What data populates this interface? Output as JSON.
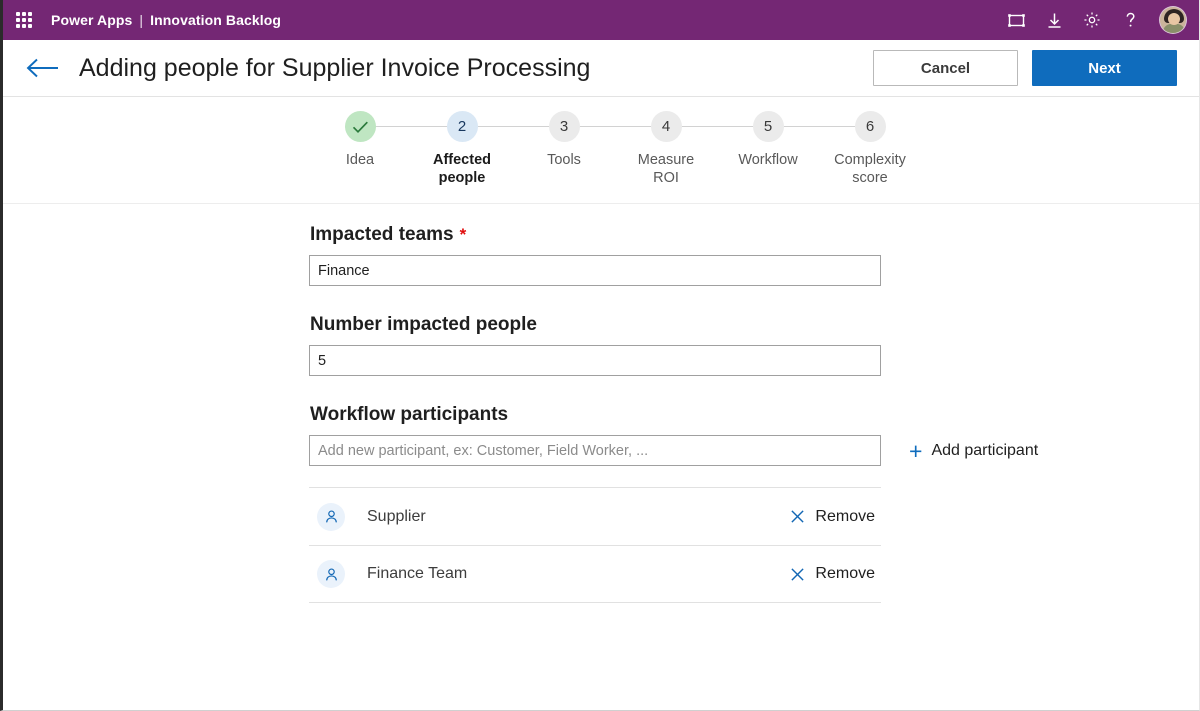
{
  "suitebar": {
    "waffle_name": "app-launcher",
    "brand_product": "Power Apps",
    "brand_separator": "|",
    "brand_app": "Innovation Backlog",
    "icons": [
      {
        "name": "fullscreen-icon",
        "title": "Fullscreen"
      },
      {
        "name": "download-icon",
        "title": "Download"
      },
      {
        "name": "gear-icon",
        "title": "Settings"
      },
      {
        "name": "help-icon",
        "title": "Help"
      }
    ],
    "avatar_name": "user-avatar"
  },
  "header": {
    "back_label": "Back",
    "title": "Adding people for Supplier Invoice Processing",
    "cancel_label": "Cancel",
    "next_label": "Next"
  },
  "stepper": {
    "current": 2,
    "steps": [
      {
        "number": "1",
        "glyph": "check",
        "label": "Idea",
        "state": "done"
      },
      {
        "number": "2",
        "glyph": "2",
        "label": "Affected\npeople",
        "state": "active"
      },
      {
        "number": "3",
        "glyph": "3",
        "label": "Tools",
        "state": "todo"
      },
      {
        "number": "4",
        "glyph": "4",
        "label": "Measure\nROI",
        "state": "todo"
      },
      {
        "number": "5",
        "glyph": "5",
        "label": "Workflow",
        "state": "todo"
      },
      {
        "number": "6",
        "glyph": "6",
        "label": "Complexity\nscore",
        "state": "todo"
      }
    ]
  },
  "form": {
    "impacted_teams": {
      "label": "Impacted teams",
      "required_marker": "*",
      "value": "Finance",
      "placeholder": ""
    },
    "number_impacted_people": {
      "label": "Number impacted people",
      "value": "5",
      "placeholder": ""
    },
    "workflow_participants": {
      "label": "Workflow participants",
      "value": "",
      "placeholder": "Add new participant, ex: Customer, Field Worker, ...",
      "add_label": "Add participant",
      "add_icon": "plus-icon",
      "participants": [
        {
          "name": "Supplier",
          "remove_label": "Remove",
          "icon": "person-icon"
        },
        {
          "name": "Finance Team",
          "remove_label": "Remove",
          "icon": "person-icon"
        }
      ]
    }
  },
  "colors": {
    "suitebar_purple": "#742774",
    "primary_blue": "#0f6cbd",
    "required_red": "#e00b0b",
    "step_done_green": "#bfe6c2",
    "step_active_blue": "#dae8f5",
    "step_todo_gray": "#ebebeb"
  }
}
